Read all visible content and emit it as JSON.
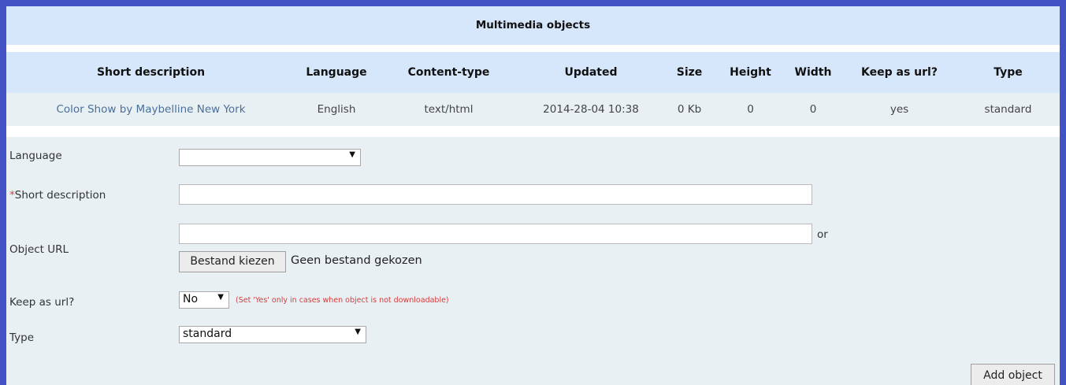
{
  "panel": {
    "title": "Multimedia objects"
  },
  "table": {
    "headers": {
      "short_description": "Short description",
      "language": "Language",
      "content_type": "Content-type",
      "updated": "Updated",
      "size": "Size",
      "height": "Height",
      "width": "Width",
      "keep_as_url": "Keep as url?",
      "type": "Type"
    },
    "rows": [
      {
        "short_description": "Color Show by Maybelline New York",
        "language": "English",
        "content_type": "text/html",
        "updated": "2014-28-04 10:38",
        "size": "0 Kb",
        "height": "0",
        "width": "0",
        "keep_as_url": "yes",
        "type": "standard"
      }
    ]
  },
  "form": {
    "language_label": "Language",
    "language_value": "",
    "required_mark": "*",
    "short_description_label": "Short description",
    "short_description_value": "",
    "object_url_label": "Object URL",
    "object_url_value": "",
    "or_text": "or",
    "choose_file_label": "Bestand kiezen",
    "no_file_text": "Geen bestand gekozen",
    "keep_as_url_label": "Keep as url?",
    "keep_as_url_value": "No",
    "keep_as_url_hint": "(Set 'Yes' only in cases when object is not downloadable)",
    "type_label": "Type",
    "type_value": "standard",
    "add_button_label": "Add object"
  },
  "colors": {
    "outer_border": "#4352c4",
    "header_bg": "#d6e7fb",
    "panel_bg": "#e9f0f4",
    "link": "#4a6f9a",
    "hint": "#d23c3c"
  }
}
